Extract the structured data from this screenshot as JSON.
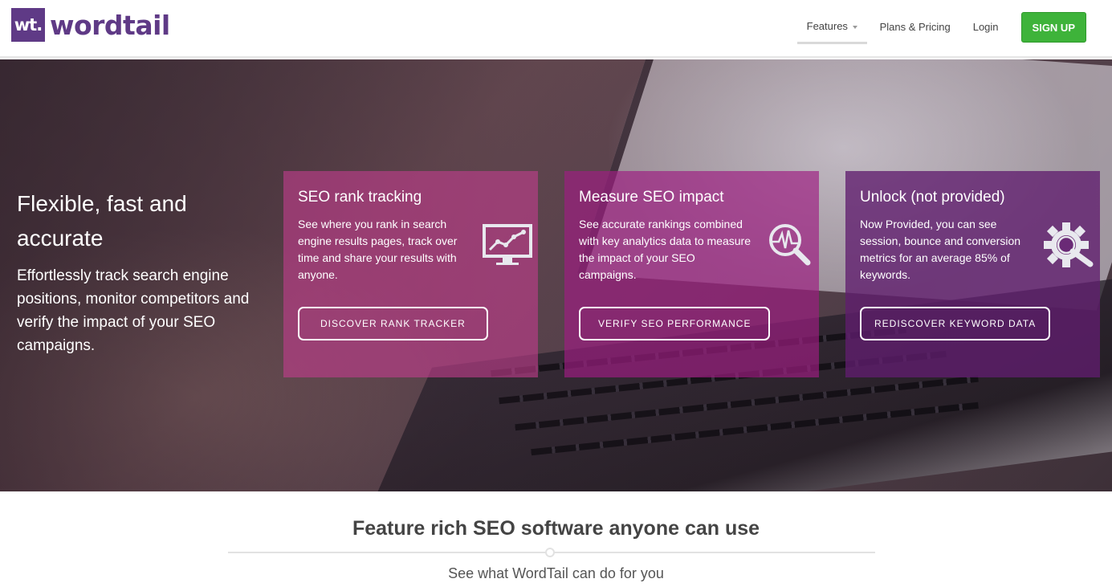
{
  "header": {
    "logo_mark": "wt.",
    "logo_text": "wordtail",
    "nav": [
      {
        "label": "Features"
      },
      {
        "label": "Plans & Pricing"
      },
      {
        "label": "Login"
      }
    ],
    "signup_label": "SIGN UP",
    "accent": "#3eb33a",
    "brand": "#5f3a86"
  },
  "hero": {
    "title": "Flexible, fast and accurate",
    "subtitle": "Effortlessly track search engine positions, monitor competitors and verify the impact of your SEO campaigns.",
    "cards": [
      {
        "title": "SEO rank tracking",
        "text": "See where you rank in search engine results pages, track over time and share your results with anyone.",
        "button": "DISCOVER RANK TRACKER",
        "icon": "chart-monitor-icon"
      },
      {
        "title": "Measure SEO impact",
        "text": "See accurate rankings combined with key analytics data to measure the impact of your SEO campaigns.",
        "button": "VERIFY SEO PERFORMANCE",
        "icon": "pulse-magnifier-icon"
      },
      {
        "title": "Unlock (not provided)",
        "text": "Now Provided, you can see session, bounce and conversion metrics for an average 85% of keywords.",
        "button": "REDISCOVER KEYWORD DATA",
        "icon": "gear-magnifier-icon"
      }
    ]
  },
  "section": {
    "title": "Feature rich SEO software anyone can use",
    "subtitle": "See what WordTail can do for you"
  }
}
